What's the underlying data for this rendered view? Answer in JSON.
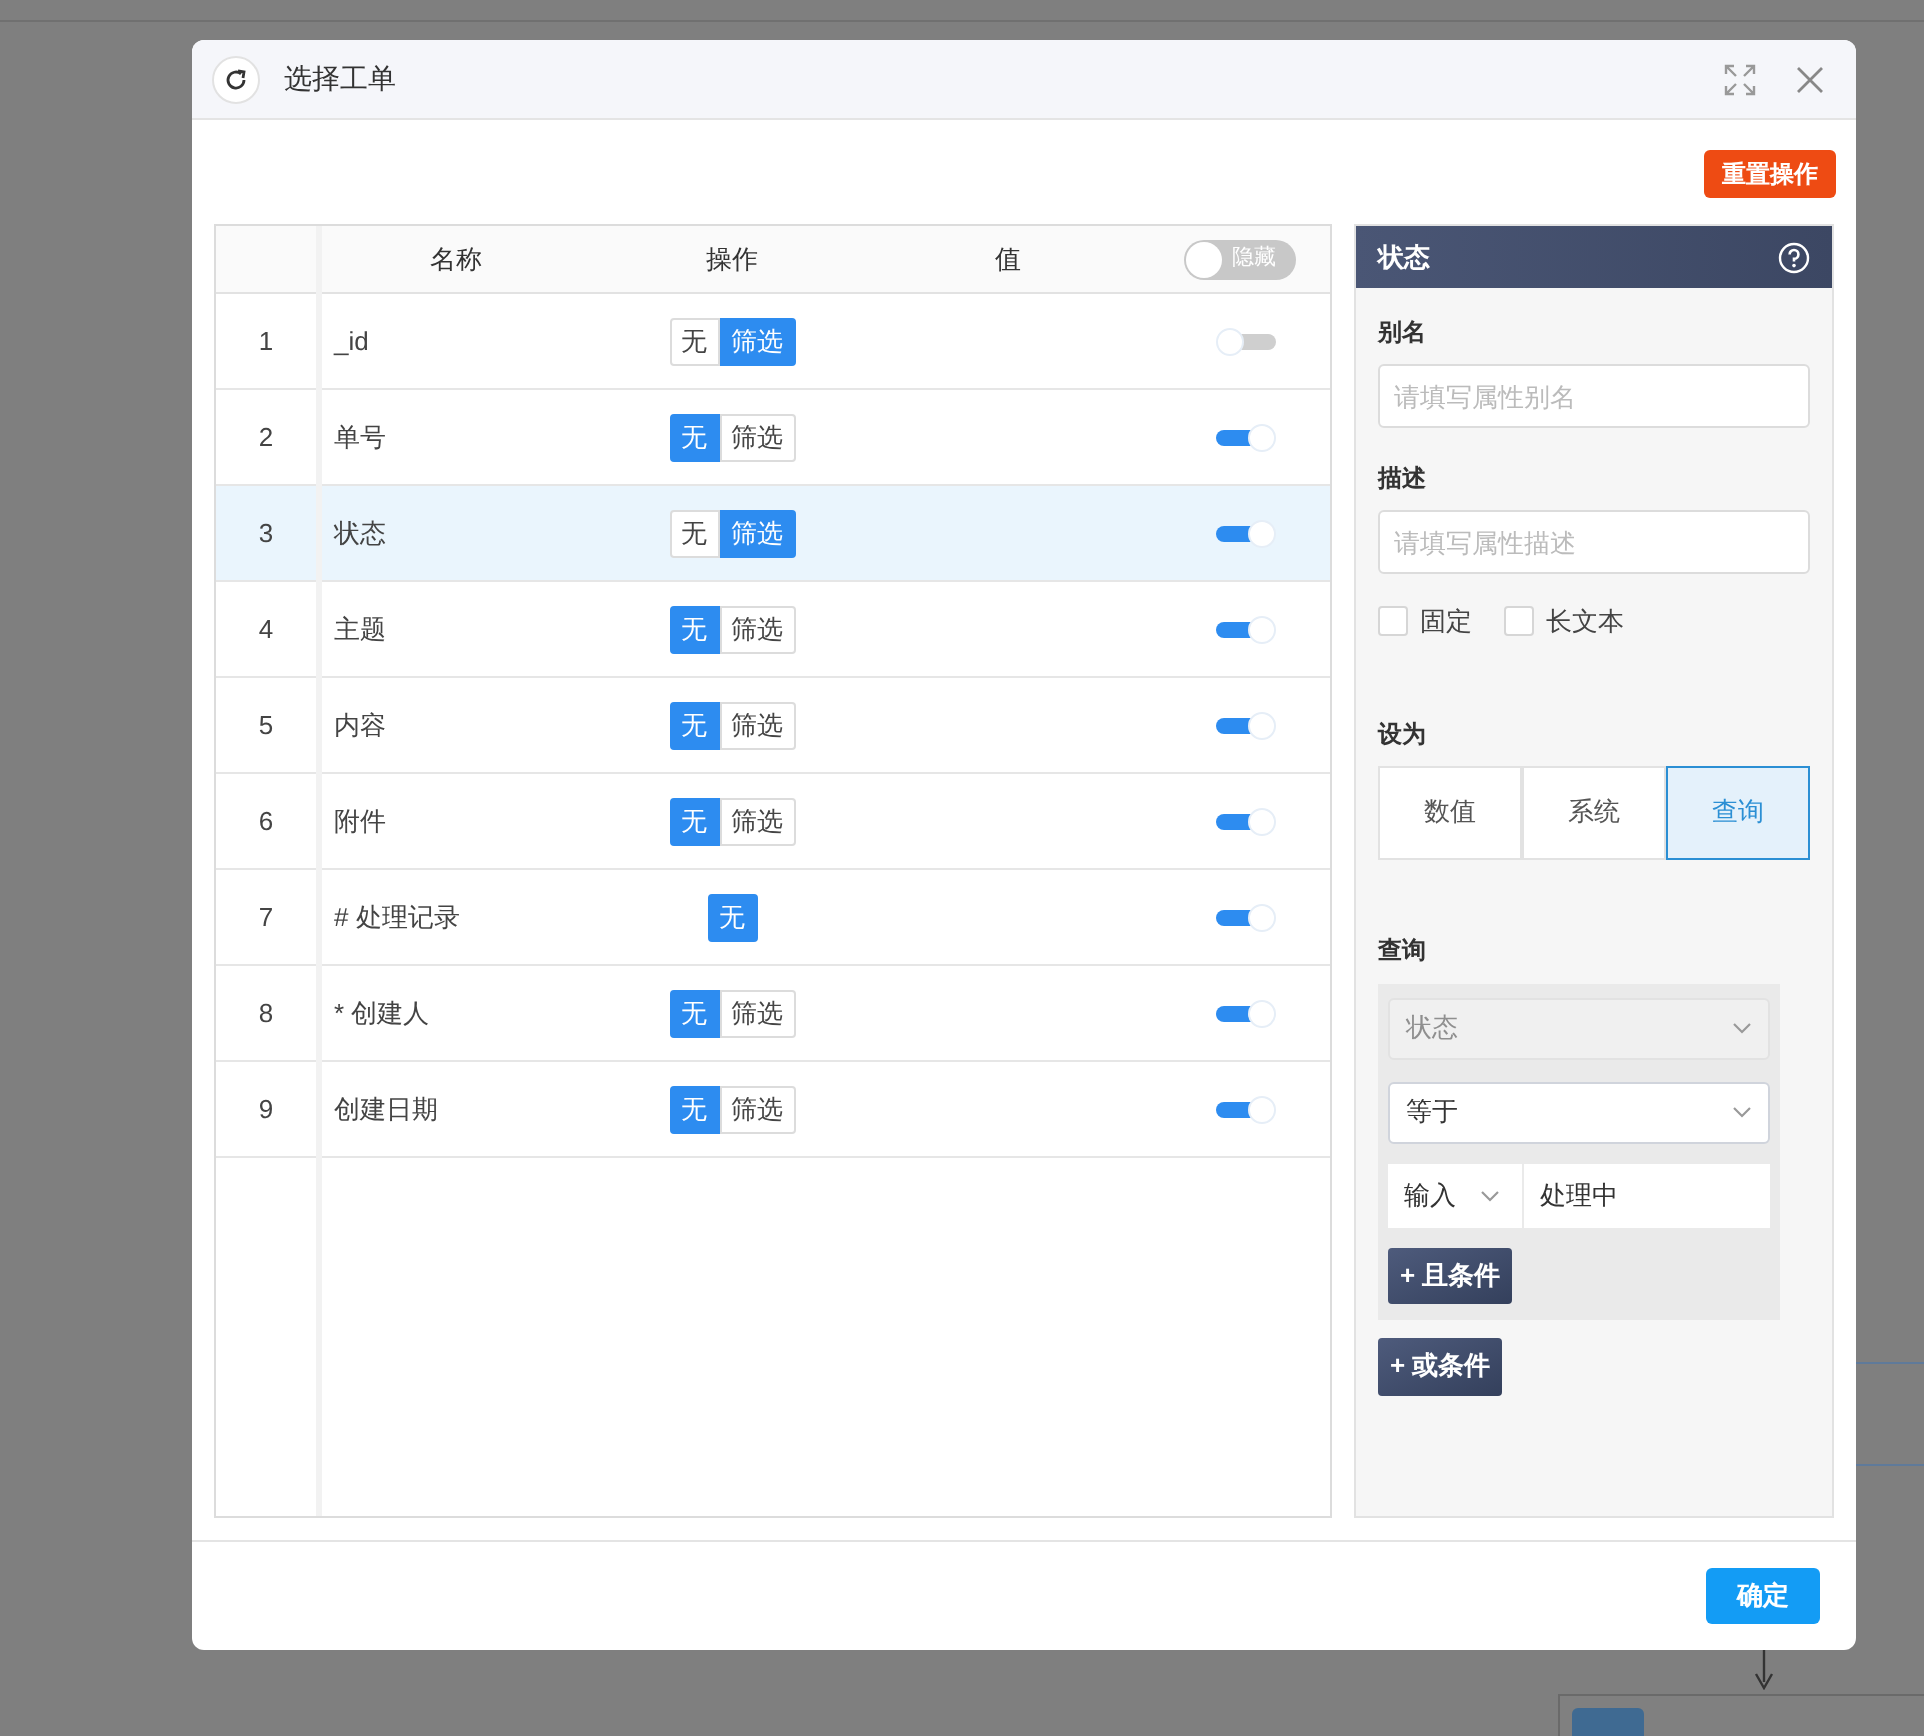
{
  "dialog": {
    "title": "选择工单",
    "reset_button": "重置操作",
    "confirm_button": "确定"
  },
  "table": {
    "columns": [
      "名称",
      "操作",
      "值"
    ],
    "hide_toggle": {
      "label": "隐藏",
      "on": false
    },
    "rows": [
      {
        "index": "1",
        "name": "_id",
        "selected": false,
        "visible": false,
        "options": [
          {
            "label": "无",
            "selected": false
          },
          {
            "label": "筛选",
            "selected": true
          }
        ]
      },
      {
        "index": "2",
        "name": "单号",
        "selected": false,
        "visible": true,
        "options": [
          {
            "label": "无",
            "selected": true
          },
          {
            "label": "筛选",
            "selected": false
          }
        ]
      },
      {
        "index": "3",
        "name": "状态",
        "selected": true,
        "visible": true,
        "options": [
          {
            "label": "无",
            "selected": false
          },
          {
            "label": "筛选",
            "selected": true
          }
        ]
      },
      {
        "index": "4",
        "name": "主题",
        "selected": false,
        "visible": true,
        "options": [
          {
            "label": "无",
            "selected": true
          },
          {
            "label": "筛选",
            "selected": false
          }
        ]
      },
      {
        "index": "5",
        "name": "内容",
        "selected": false,
        "visible": true,
        "options": [
          {
            "label": "无",
            "selected": true
          },
          {
            "label": "筛选",
            "selected": false
          }
        ]
      },
      {
        "index": "6",
        "name": "附件",
        "selected": false,
        "visible": true,
        "options": [
          {
            "label": "无",
            "selected": true
          },
          {
            "label": "筛选",
            "selected": false
          }
        ]
      },
      {
        "index": "7",
        "name": "# 处理记录",
        "selected": false,
        "visible": true,
        "options": [
          {
            "label": "无",
            "selected": true
          }
        ]
      },
      {
        "index": "8",
        "name": "* 创建人",
        "selected": false,
        "visible": true,
        "options": [
          {
            "label": "无",
            "selected": true
          },
          {
            "label": "筛选",
            "selected": false
          }
        ]
      },
      {
        "index": "9",
        "name": "创建日期",
        "selected": false,
        "visible": true,
        "options": [
          {
            "label": "无",
            "selected": true
          },
          {
            "label": "筛选",
            "selected": false
          }
        ]
      }
    ]
  },
  "panel": {
    "title": "状态",
    "alias": {
      "label": "别名",
      "placeholder": "请填写属性别名"
    },
    "description": {
      "label": "描述",
      "placeholder": "请填写属性描述"
    },
    "checkboxes": [
      {
        "label": "固定",
        "checked": false
      },
      {
        "label": "长文本",
        "checked": false
      }
    ],
    "set_as": {
      "label": "设为",
      "options": [
        {
          "label": "数值",
          "selected": false
        },
        {
          "label": "系统",
          "selected": false
        },
        {
          "label": "查询",
          "selected": true
        }
      ]
    },
    "query": {
      "label": "查询",
      "field": {
        "value": "状态",
        "disabled": true
      },
      "operator": {
        "value": "等于"
      },
      "source": {
        "value": "输入"
      },
      "value": "处理中",
      "and_button": "+ 且条件"
    },
    "or_button": "+ 或条件"
  }
}
